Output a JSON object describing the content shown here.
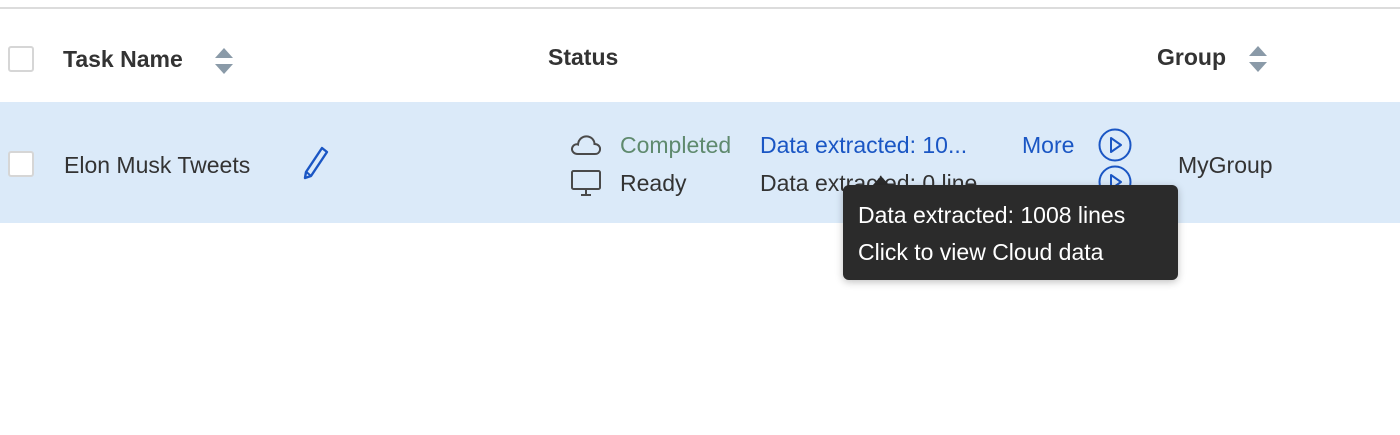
{
  "table": {
    "headers": {
      "task_name": "Task Name",
      "status": "Status",
      "group": "Group"
    },
    "rows": [
      {
        "task_name": "Elon Musk Tweets",
        "cloud_status": "Completed",
        "local_status": "Ready",
        "cloud_data": "Data extracted: 10...",
        "local_data": "Data extracted: 0 line",
        "more_label": "More",
        "group": "MyGroup"
      }
    ]
  },
  "tooltip": {
    "line1": "Data extracted: 1008 lines",
    "line2": "Click to view Cloud data"
  },
  "colors": {
    "row_selected_bg": "#dbeaf9",
    "link_blue": "#1a56c4",
    "completed_green": "#5f8a6e",
    "tooltip_bg": "#2b2b2b"
  },
  "icons": {
    "sort": "sort-icon",
    "edit": "pencil-icon",
    "cloud": "cloud-icon",
    "local": "monitor-icon",
    "play": "play-circle-icon"
  }
}
